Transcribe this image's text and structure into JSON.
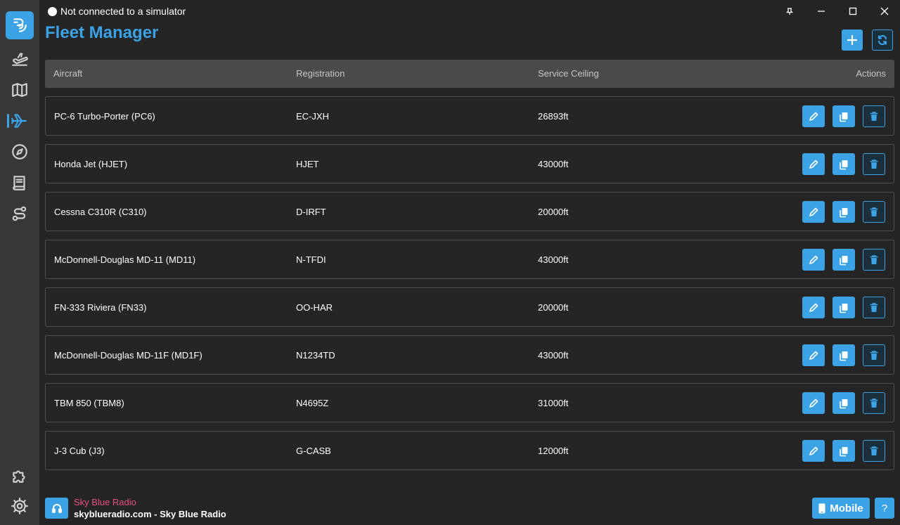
{
  "titlebar": {
    "status_text": "Not connected to a simulator"
  },
  "page": {
    "title": "Fleet Manager"
  },
  "toolbar": {
    "add_icon": "plus-icon",
    "refresh_icon": "refresh-icon"
  },
  "sidebar": {
    "items": [
      {
        "icon": "app-logo-icon"
      },
      {
        "icon": "departure-icon"
      },
      {
        "icon": "map-icon"
      },
      {
        "icon": "airplane-icon",
        "active": true
      },
      {
        "icon": "compass-icon"
      },
      {
        "icon": "book-icon"
      },
      {
        "icon": "route-icon"
      },
      {
        "icon": "puzzle-icon"
      },
      {
        "icon": "settings-icon"
      }
    ]
  },
  "table": {
    "headers": {
      "aircraft": "Aircraft",
      "registration": "Registration",
      "ceiling": "Service Ceiling",
      "actions": "Actions"
    },
    "rows": [
      {
        "aircraft": "PC-6 Turbo-Porter (PC6)",
        "registration": "EC-JXH",
        "ceiling": "26893ft"
      },
      {
        "aircraft": "Honda Jet (HJET)",
        "registration": "HJET",
        "ceiling": "43000ft"
      },
      {
        "aircraft": "Cessna C310R (C310)",
        "registration": "D-IRFT",
        "ceiling": "20000ft"
      },
      {
        "aircraft": "McDonnell-Douglas MD-11 (MD11)",
        "registration": "N-TFDI",
        "ceiling": "43000ft"
      },
      {
        "aircraft": "FN-333 Riviera (FN33)",
        "registration": "OO-HAR",
        "ceiling": "20000ft"
      },
      {
        "aircraft": "McDonnell-Douglas MD-11F (MD1F)",
        "registration": "N1234TD",
        "ceiling": "43000ft"
      },
      {
        "aircraft": "TBM 850 (TBM8)",
        "registration": "N4695Z",
        "ceiling": "31000ft"
      },
      {
        "aircraft": "J-3 Cub (J3)",
        "registration": "G-CASB",
        "ceiling": "12000ft"
      }
    ]
  },
  "footer": {
    "radio_name": "Sky Blue Radio",
    "radio_subtitle": "skyblueradio.com - Sky Blue Radio",
    "mobile_label": "Mobile",
    "help_label": "?"
  },
  "colors": {
    "accent": "#3ba2e6",
    "radio_name": "#e8507a",
    "background": "#252525",
    "sidebar": "#383838"
  }
}
